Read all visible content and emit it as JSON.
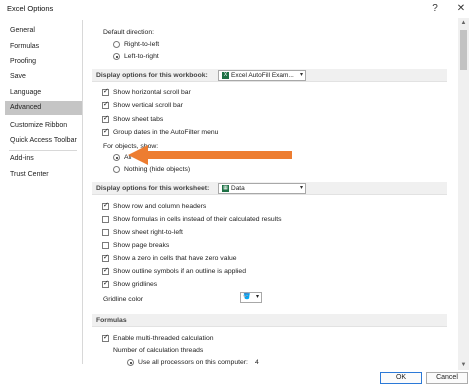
{
  "window": {
    "title": "Excel Options",
    "help_glyph": "?",
    "close_glyph": "✕"
  },
  "sidebar": {
    "items": [
      {
        "label": "General",
        "active": false
      },
      {
        "label": "Formulas",
        "active": false
      },
      {
        "label": "Proofing",
        "active": false
      },
      {
        "label": "Save",
        "active": false
      },
      {
        "label": "Language",
        "active": false
      },
      {
        "label": "Advanced",
        "active": true
      },
      {
        "label": "Customize Ribbon",
        "active": false
      },
      {
        "label": "Quick Access Toolbar",
        "active": false
      },
      {
        "label": "Add-ins",
        "active": false
      },
      {
        "label": "Trust Center",
        "active": false
      }
    ]
  },
  "direction": {
    "label": "Default direction:",
    "options": [
      "Right-to-left",
      "Left-to-right"
    ],
    "selected": "Left-to-right"
  },
  "workbook_section": {
    "header": "Display options for this workbook:",
    "dropdown_value": "Excel AutoFill Exam...",
    "checkboxes": [
      {
        "label": "Show horizontal scroll bar",
        "checked": true
      },
      {
        "label": "Show vertical scroll bar",
        "checked": true
      },
      {
        "label": "Show sheet tabs",
        "checked": true
      },
      {
        "label": "Group dates in the AutoFilter menu",
        "checked": true
      }
    ],
    "objects_label": "For objects, show:",
    "objects_options": [
      "All",
      "Nothing (hide objects)"
    ],
    "objects_selected": "All"
  },
  "worksheet_section": {
    "header": "Display options for this worksheet:",
    "dropdown_value": "Data",
    "checkboxes": [
      {
        "label": "Show row and column headers",
        "checked": true
      },
      {
        "label": "Show formulas in cells instead of their calculated results",
        "checked": false
      },
      {
        "label": "Show sheet right-to-left",
        "checked": false
      },
      {
        "label": "Show page breaks",
        "checked": false
      },
      {
        "label": "Show a zero in cells that have zero value",
        "checked": true
      },
      {
        "label": "Show outline symbols if an outline is applied",
        "checked": true
      },
      {
        "label": "Show gridlines",
        "checked": true
      }
    ],
    "gridline_label": "Gridline color"
  },
  "formulas_section": {
    "header": "Formulas",
    "checkboxes": [
      {
        "label": "Enable multi-threaded calculation",
        "checked": true
      }
    ],
    "threads_label": "Number of calculation threads",
    "threads_option": "Use all processors on this computer:",
    "threads_count": "4"
  },
  "footer": {
    "ok_label": "OK",
    "cancel_label": "Cancel"
  },
  "colors": {
    "active_sidebar": "#c5c5c5",
    "arrow": "#ed7d31",
    "excel_green": "#1e7145"
  }
}
